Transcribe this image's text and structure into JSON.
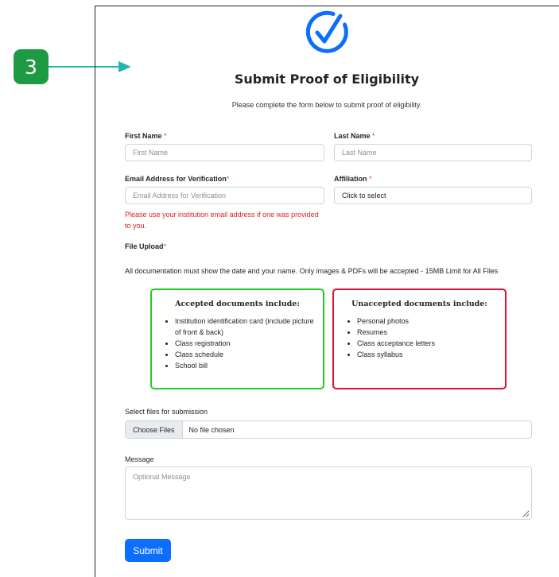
{
  "step": {
    "number": "3"
  },
  "form": {
    "title": "Submit Proof of Eligibility",
    "subtitle": "Please complete the form below to submit proof of eligibility."
  },
  "fields": {
    "first_name": {
      "label": "First Name",
      "required_mark": "*",
      "placeholder": "First Name"
    },
    "last_name": {
      "label": "Last Name",
      "required_mark": "*",
      "placeholder": "Last Name"
    },
    "email": {
      "label": "Email Address for Verification",
      "required_mark": "*",
      "placeholder": "Email Address for Verification",
      "hint": "Please use your institution email address if one was provided to you."
    },
    "affiliation": {
      "label": "Affiliation",
      "required_mark": "*",
      "value": "Click to select"
    }
  },
  "upload": {
    "label": "File Upload",
    "required_mark": "*",
    "note": "All documentation must show the date and your name. Only images & PDFs will be accepted - 15MB Limit for All Files",
    "accepted": {
      "heading": "Accepted documents include:",
      "items": [
        "Institution identification card (include picture of front & back)",
        "Class registration",
        "Class schedule",
        "School bill"
      ]
    },
    "unaccepted": {
      "heading": "Unaccepted documents include:",
      "items": [
        "Personal photos",
        "Resumes",
        "Class acceptance letters",
        "Class syllabus"
      ]
    },
    "select_label": "Select files for submission",
    "choose_button": "Choose Files",
    "file_status": "No file chosen"
  },
  "message": {
    "label": "Message",
    "placeholder": "Optional Message"
  },
  "submit": {
    "label": "Submit"
  },
  "colors": {
    "primary": "#0d6efd",
    "accepted_border": "#22cc22",
    "unaccepted_border": "#dd1133",
    "required": "#dc3545",
    "step_badge": "#1e9a45",
    "arrow": "#22b8b0"
  }
}
